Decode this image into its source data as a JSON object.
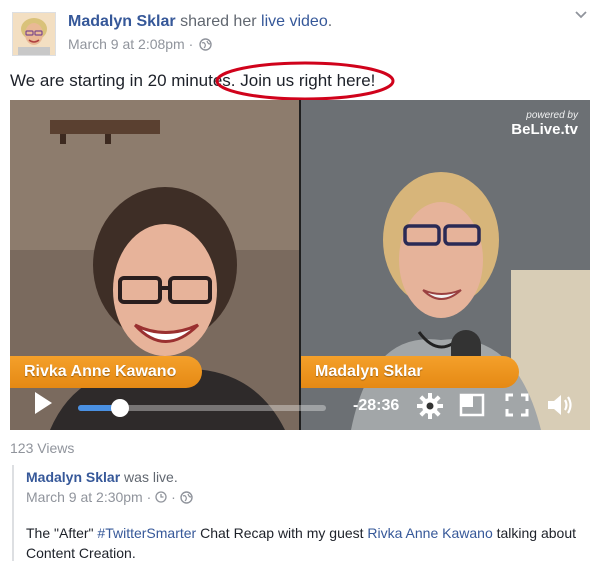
{
  "post": {
    "author": "Madalyn Sklar",
    "action": "shared her",
    "object_link": "live video",
    "object_period": ".",
    "date": "March 9 at 2:08pm",
    "separator": "·",
    "text": "We are starting in 20 minutes. Join us right here!"
  },
  "video": {
    "left_name": "Rivka Anne Kawano",
    "right_name": "Madalyn Sklar",
    "powered_small": "powered by",
    "powered_brand": "BeLive.tv",
    "time_remaining": "-28:36",
    "progress_fraction": 0.17
  },
  "views": "123 Views",
  "shared": {
    "author": "Madalyn Sklar",
    "action": "was live.",
    "date": "March 9 at 2:30pm",
    "separator": "·",
    "text_before": "The \"After\" ",
    "hashtag": "#TwitterSmarter",
    "text_middle": " Chat Recap with my guest ",
    "guest": "Rivka Anne Kawano",
    "text_after": " talking about Content Creation."
  },
  "colors": {
    "link": "#365899",
    "accent_orange": "#f4a02a",
    "progress_blue": "#4a90e2",
    "annotation_red": "#d0021b"
  }
}
